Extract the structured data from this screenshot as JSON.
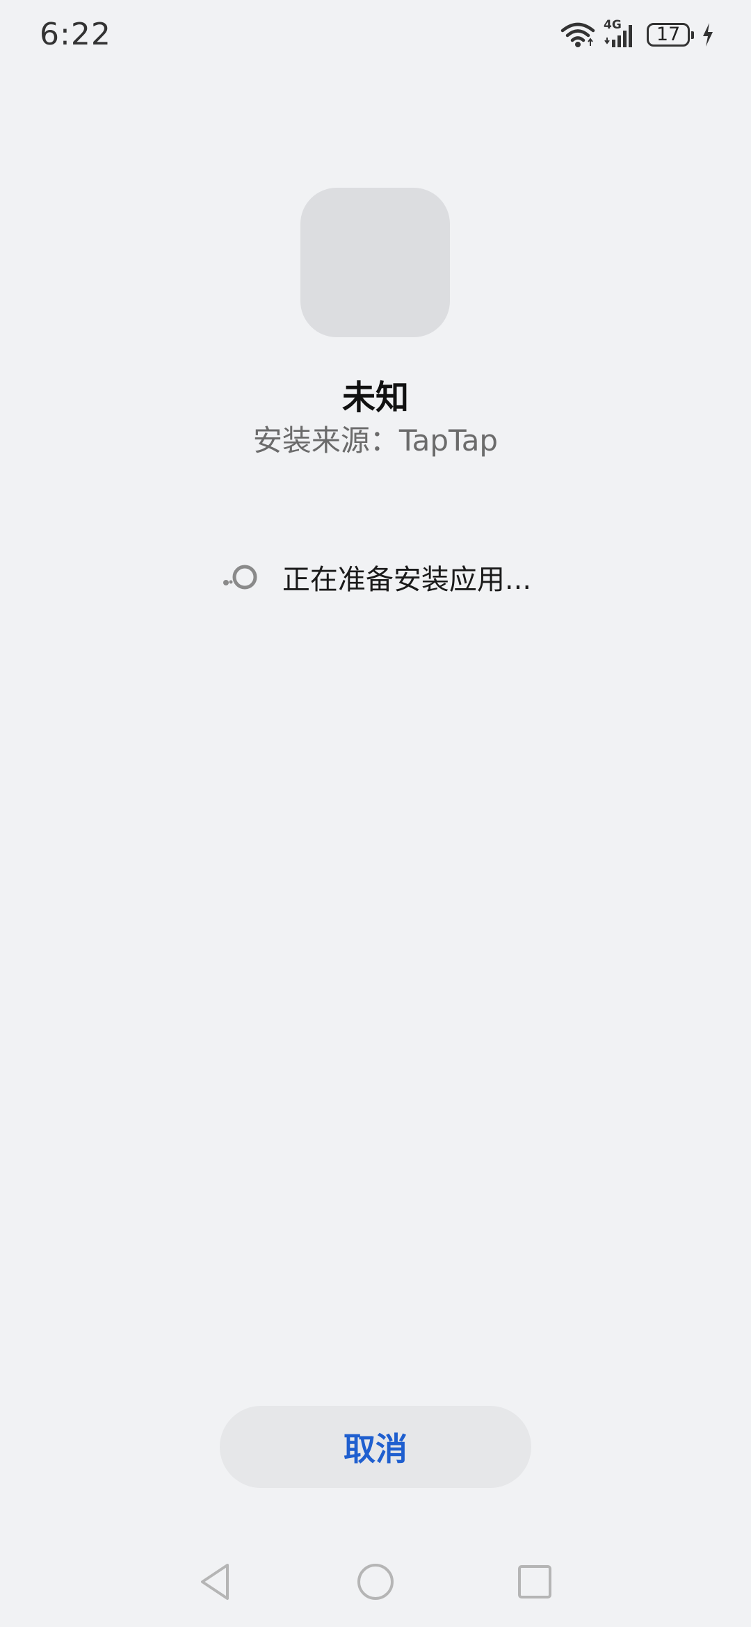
{
  "status_bar": {
    "time": "6:22",
    "network_label": "4G",
    "battery_level": "17",
    "icons": [
      "wifi-icon",
      "signal-icon",
      "battery-icon",
      "charging-icon"
    ]
  },
  "app": {
    "name": "未知",
    "source": "安装来源：TapTap"
  },
  "progress": {
    "text": "正在准备安装应用..."
  },
  "actions": {
    "cancel_label": "取消"
  },
  "navigation": {
    "icons": [
      "back-icon",
      "home-icon",
      "recents-icon"
    ]
  },
  "colors": {
    "background": "#f1f2f4",
    "accent": "#1f5fcf",
    "button_background": "#e6e7e9",
    "icon_placeholder": "#dcdde0"
  }
}
